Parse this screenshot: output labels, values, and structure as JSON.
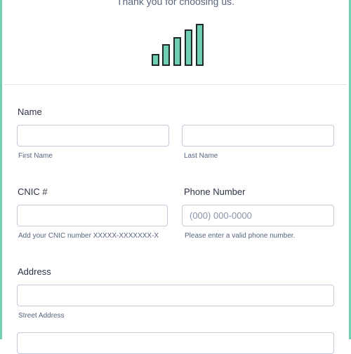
{
  "header": {
    "thanks_text": "Thank you for choosing us.",
    "logo_icon": "signal-bars-icon",
    "accent_color": "#6fcfb0"
  },
  "fields": {
    "name": {
      "label": "Name",
      "first_value": "",
      "first_sublabel": "First Name",
      "last_value": "",
      "last_sublabel": "Last Name"
    },
    "cnic": {
      "label": "CNIC #",
      "value": "",
      "sublabel": "Add your CNIC number XXXXX-XXXXXXX-X"
    },
    "phone": {
      "label": "Phone Number",
      "value": "",
      "placeholder": "(000) 000-0000",
      "sublabel": "Please enter a valid phone number."
    },
    "address": {
      "label": "Address",
      "street_value": "",
      "street_sublabel": "Street Address",
      "line2_value": ""
    }
  }
}
